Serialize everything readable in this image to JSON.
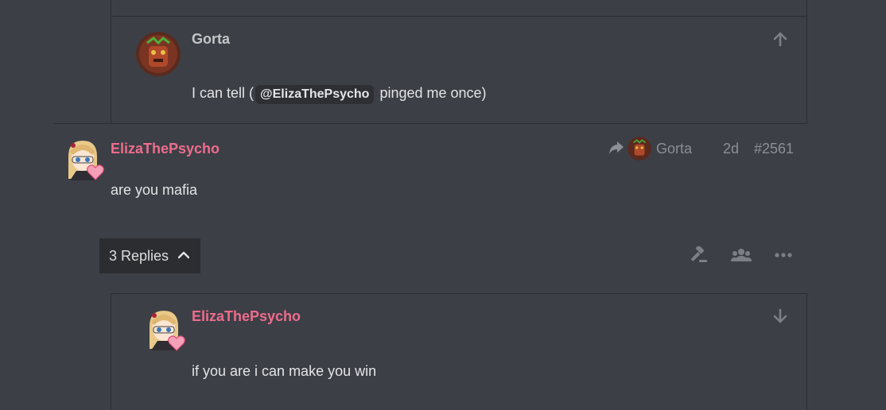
{
  "quoted_post": {
    "author": "Gorta",
    "text_before": "I can tell (",
    "mention": "@ElizaThePsycho",
    "text_after": " pinged me once)",
    "action_icon": "arrow-up-icon"
  },
  "post": {
    "author": "ElizaThePsycho",
    "text": "are you mafia",
    "reply_to_icon": "reply-arrow-icon",
    "reply_to_user": "Gorta",
    "age": "2d",
    "post_number": "#2561",
    "replies_label": "3 Replies",
    "actions": [
      "gavel-icon",
      "users-icon",
      "more-icon"
    ]
  },
  "reply_post": {
    "author": "ElizaThePsycho",
    "text": "if you are i can make you win",
    "action_icon": "arrow-down-icon"
  },
  "colors": {
    "background": "#3c3f45",
    "border": "#2b2d31",
    "username_pink": "#ee6c8e",
    "username_gray": "#c4c6c9",
    "muted": "#8c8f94"
  }
}
